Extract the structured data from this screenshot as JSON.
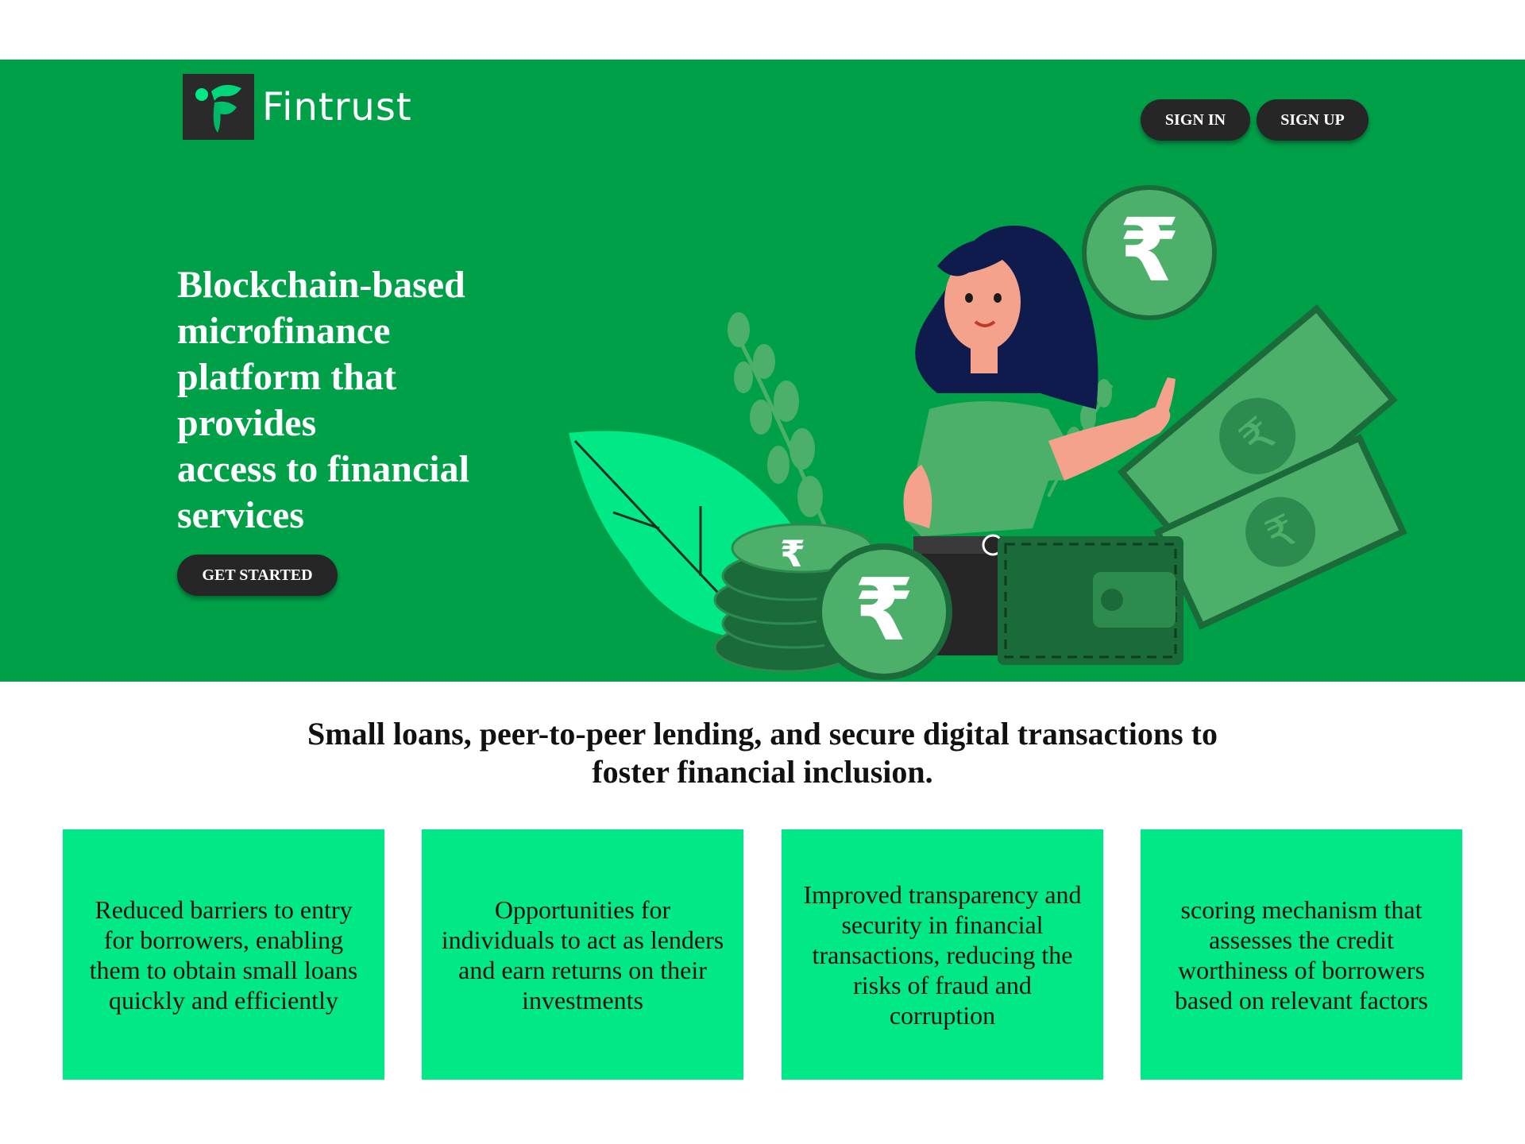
{
  "brand": {
    "name": "Fintrust",
    "logo_icon": "fintrust-f-logo"
  },
  "nav": {
    "sign_in": "SIGN IN",
    "sign_up": "SIGN UP"
  },
  "hero": {
    "headline_lines": [
      "Blockchain-based",
      "microfinance",
      "platform that",
      "provides",
      "access to financial",
      "services"
    ],
    "cta": "GET STARTED",
    "illustration": "woman-with-rupee-coins-wallet-banknotes",
    "currency_symbol": "₹"
  },
  "tagline_lines": [
    "Small loans, peer-to-peer lending, and secure digital transactions to",
    "foster financial inclusion."
  ],
  "features": [
    "Reduced barriers to entry for borrowers, enabling them to obtain small loans quickly and efficiently",
    "Opportunities for individuals to act as lenders and earn returns on their investments",
    "Improved transparency and security in financial transactions, reducing the risks of fraud and corruption",
    "scoring mechanism that assesses the credit worthiness of borrowers based on  relevant factors"
  ],
  "colors": {
    "hero_bg": "#00a049",
    "card_bg": "#00e986",
    "button_bg": "#262626",
    "coin_green": "#4caf6a",
    "dark_green": "#1b6b3a"
  }
}
